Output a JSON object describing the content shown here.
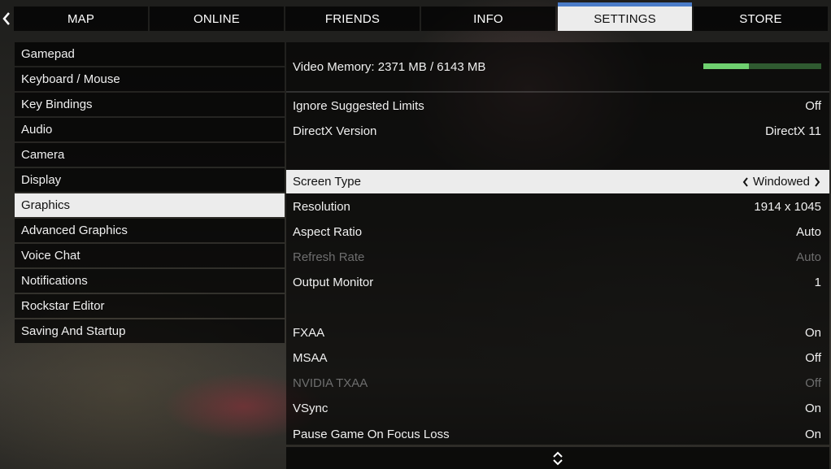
{
  "tabs": [
    {
      "label": "MAP"
    },
    {
      "label": "ONLINE"
    },
    {
      "label": "FRIENDS"
    },
    {
      "label": "INFO"
    },
    {
      "label": "SETTINGS"
    },
    {
      "label": "STORE"
    }
  ],
  "active_tab": "SETTINGS",
  "menu": {
    "items": [
      {
        "label": "Gamepad"
      },
      {
        "label": "Keyboard / Mouse"
      },
      {
        "label": "Key Bindings"
      },
      {
        "label": "Audio"
      },
      {
        "label": "Camera"
      },
      {
        "label": "Display"
      },
      {
        "label": "Graphics"
      },
      {
        "label": "Advanced Graphics"
      },
      {
        "label": "Voice Chat"
      },
      {
        "label": "Notifications"
      },
      {
        "label": "Rockstar Editor"
      },
      {
        "label": "Saving And Startup"
      }
    ],
    "active": "Graphics"
  },
  "video_memory": {
    "label": "Video Memory: 2371 MB / 6143 MB",
    "used_fraction": 0.386,
    "bar_color": "#6fd06f",
    "bar_bg_color": "#2f5a30"
  },
  "settings": {
    "rows": [
      {
        "label": "Ignore Suggested Limits",
        "value": "Off"
      },
      {
        "label": "DirectX Version",
        "value": "DirectX 11"
      },
      {
        "label": "Screen Type",
        "value": "Windowed"
      },
      {
        "label": "Resolution",
        "value": "1914 x 1045"
      },
      {
        "label": "Aspect Ratio",
        "value": "Auto"
      },
      {
        "label": "Refresh Rate",
        "value": "Auto"
      },
      {
        "label": "Output Monitor",
        "value": "1"
      },
      {
        "label": "FXAA",
        "value": "On"
      },
      {
        "label": "MSAA",
        "value": "Off"
      },
      {
        "label": "NVIDIA TXAA",
        "value": "Off"
      },
      {
        "label": "VSync",
        "value": "On"
      },
      {
        "label": "Pause Game On Focus Loss",
        "value": "On"
      }
    ],
    "selected": "Screen Type",
    "disabled": [
      "Refresh Rate",
      "NVIDIA TXAA"
    ]
  },
  "colors": {
    "accent": "#4b7cc8",
    "highlight_bg": "#ececec"
  },
  "icons": {
    "back": "chevron-left-icon",
    "left_arrow": "chevron-left-icon",
    "right_arrow": "chevron-right-icon",
    "scroll": "up-down-chevron-icon"
  }
}
